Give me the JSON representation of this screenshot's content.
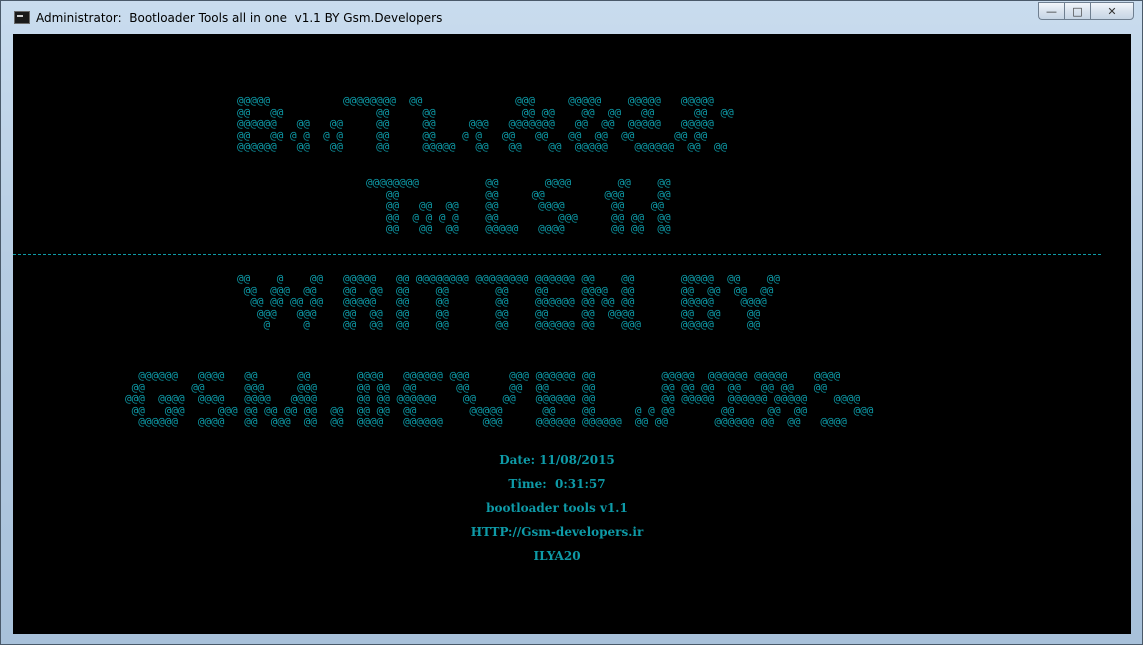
{
  "window": {
    "title": "Administrator:  Bootloader Tools all in one  v1.1 BY Gsm.Developers",
    "minimize_label": "—",
    "maximize_label": "□",
    "close_label": "✕"
  },
  "console": {
    "text_color": "#0e9aa7",
    "background": "#000000",
    "ascii_banner_bootloader": "@@@@@           @@@@@@@@  @@              @@@     @@@@@    @@@@@   @@@@@\n@@   @@              @@     @@             @@ @@    @@  @@   @@      @@  @@\n@@@@@@   @@   @@     @@     @@     @@@   @@@@@@@   @@  @@  @@@@@   @@@@@\n@@   @@ @ @  @ @     @@     @@    @ @   @@   @@   @@  @@  @@      @@ @@\n@@@@@@   @@   @@     @@     @@@@@   @@   @@    @@  @@@@@    @@@@@@  @@  @@",
    "ascii_banner_tools": "@@@@@@@@          @@       @@@@       @@    @@\n   @@             @@     @@         @@@     @@\n   @@   @@  @@    @@      @@@@       @@    @@\n   @@  @ @ @ @    @@         @@@     @@ @@  @@\n   @@   @@  @@    @@@@@   @@@@       @@ @@  @@",
    "divider": "-------------------------------------------------------------------------------------------------------------------------------------------------------------------",
    "ascii_banner_written_by": "@@    @    @@   @@@@@   @@ @@@@@@@@ @@@@@@@@ @@@@@@ @@    @@       @@@@@  @@    @@\n @@  @@@  @@    @@  @@  @@    @@       @@    @@     @@@@  @@       @@  @@  @@  @@\n  @@ @@ @@ @@   @@@@@   @@    @@       @@    @@@@@@ @@ @@ @@       @@@@@    @@@@\n   @@@   @@@    @@  @@  @@    @@       @@    @@     @@  @@@@       @@  @@    @@\n    @     @     @@  @@  @@    @@       @@    @@@@@@ @@    @@@      @@@@@     @@",
    "ascii_banner_gsm_developers": "  @@@@@@   @@@@   @@      @@       @@@@   @@@@@@ @@@      @@@ @@@@@@ @@          @@@@@  @@@@@@ @@@@@    @@@@\n @@       @@      @@@     @@@      @@ @@  @@      @@      @@  @@     @@          @@ @@ @@  @@   @@ @@   @@\n@@@  @@@@  @@@@   @@@@   @@@@      @@ @@ @@@@@@    @@    @@   @@@@@@ @@          @@ @@@@@  @@@@@@ @@@@@    @@@@\n @@   @@@     @@@ @@ @@ @@ @@  @@  @@ @@  @@        @@@@@      @@    @@      @ @ @@       @@     @@  @@       @@@\n  @@@@@@   @@@@   @@  @@@  @@  @@  @@@@   @@@@@@      @@@     @@@@@@ @@@@@@  @@ @@       @@@@@@ @@  @@   @@@@",
    "date_line": "Date: 11/08/2015",
    "time_line": "Time:  0:31:57",
    "version_line": "bootloader tools v1.1",
    "url_line": "HTTP://Gsm-developers.ir",
    "author_line": "ILYA20"
  }
}
